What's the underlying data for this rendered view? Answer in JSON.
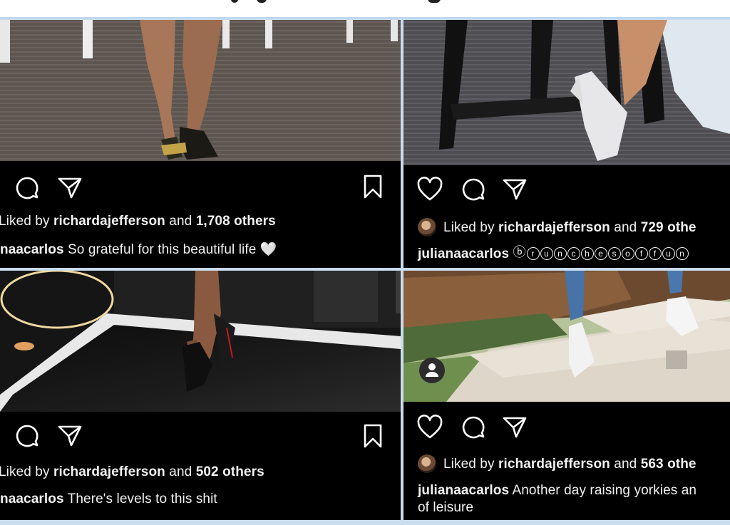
{
  "posts": [
    {
      "liked_prefix": "Liked by",
      "liked_user": "richardajefferson",
      "liked_and": "and",
      "liked_count": "1,708 others",
      "caption_user": "naacarlos",
      "caption_text": "So grateful for this beautiful life",
      "caption_emoji": "🤍"
    },
    {
      "liked_prefix": "Liked by",
      "liked_user": "richardajefferson",
      "liked_and": "and",
      "liked_count": "729 othe",
      "caption_user": "julianaacarlos",
      "caption_bubbles": [
        "ⓑ",
        "r",
        "u",
        "n",
        "c",
        "h",
        "e",
        "s",
        "o",
        "f",
        "f",
        "u",
        "n"
      ]
    },
    {
      "liked_prefix": "Liked by",
      "liked_user": "richardajefferson",
      "liked_and": "and",
      "liked_count": "502 others",
      "caption_user": "naacarlos",
      "caption_text": "There's levels to this shit"
    },
    {
      "liked_prefix": "Liked by",
      "liked_user": "richardajefferson",
      "liked_and": "and",
      "liked_count": "563 othe",
      "caption_user": "julianaacarlos",
      "caption_text": "Another day raising yorkies an",
      "caption_text_2": "of leisure"
    }
  ],
  "icons": {
    "comment": "comment-icon",
    "share": "send-icon",
    "bookmark": "bookmark-icon",
    "like": "heart-icon",
    "user_tag": "user-tag-icon"
  },
  "colors": {
    "background": "#c9dcee",
    "panel": "#000000",
    "text": "#f2f2f2"
  }
}
